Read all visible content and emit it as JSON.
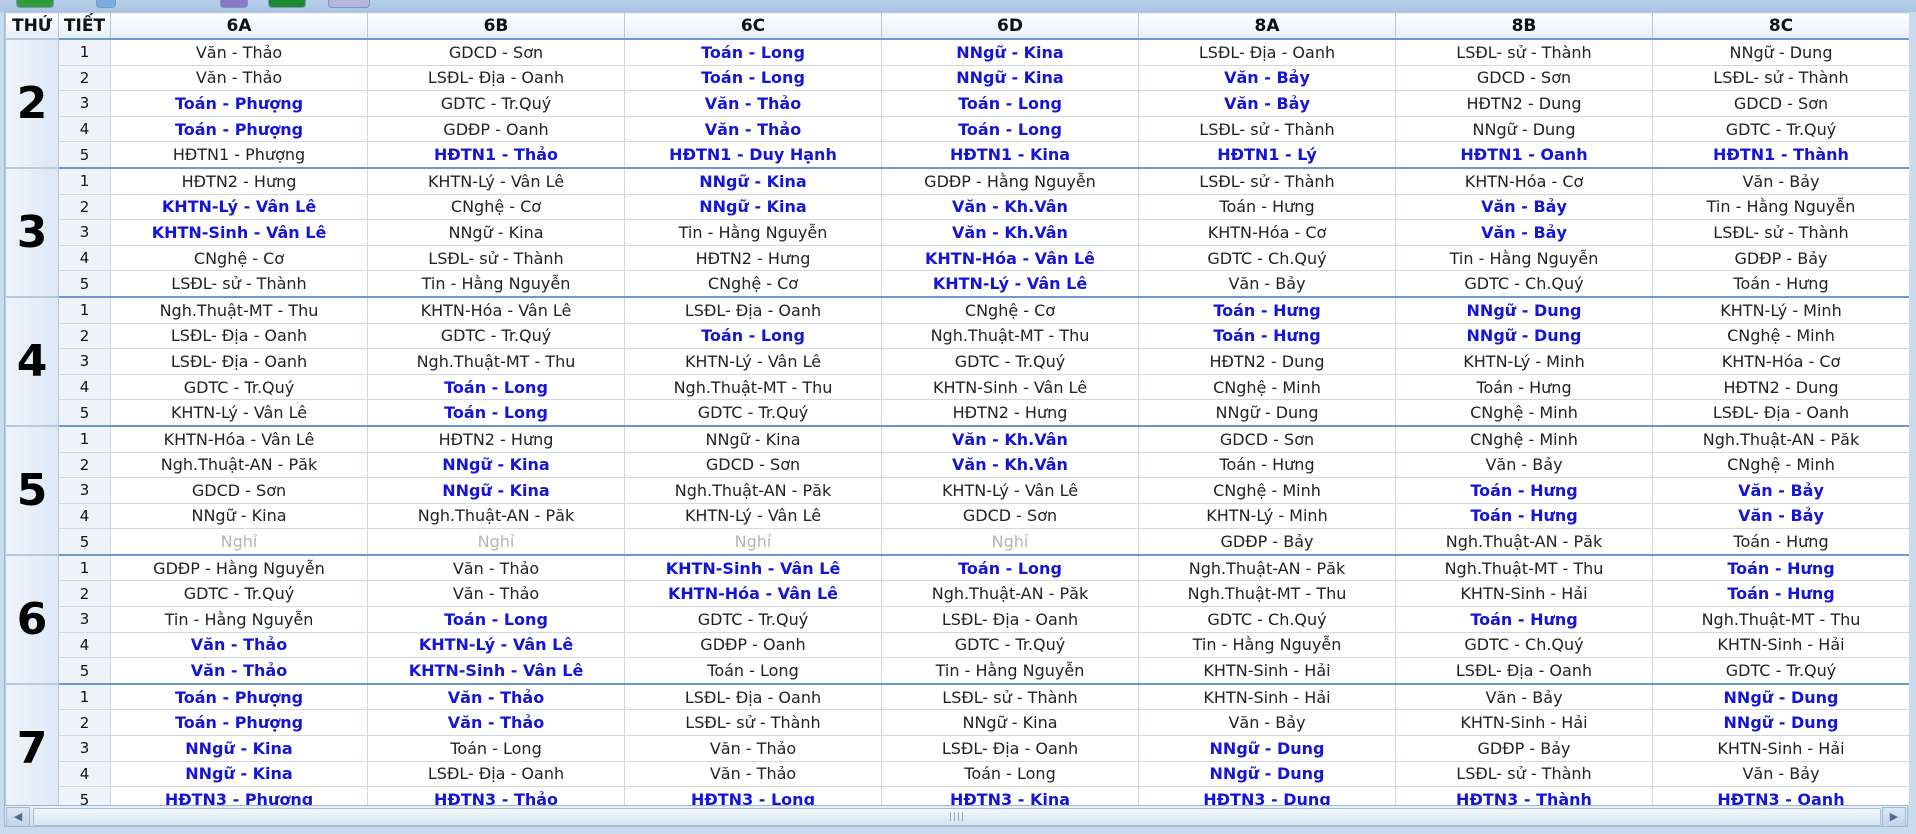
{
  "toolbar": {
    "button_colors": [
      "#2f9e3a",
      "#7aaee0",
      "#8a78c8",
      "#1e8a2e",
      "#b9b5dc"
    ]
  },
  "header": {
    "thu": "THỨ",
    "tiet": "TIẾT",
    "classes": [
      "6A",
      "6B",
      "6C",
      "6D",
      "8A",
      "8B",
      "8C"
    ]
  },
  "colors": {
    "highlight": "#1515d6",
    "normal": "#222222",
    "off": "#b5b5b5",
    "day_border": "#6d98cc"
  },
  "days": [
    {
      "day": "2",
      "rows": [
        [
          [
            "Văn - Thảo",
            0
          ],
          [
            "GDCD - Sơn",
            0
          ],
          [
            "Toán - Long",
            1
          ],
          [
            "NNgữ - Kina",
            1
          ],
          [
            "LSĐL- Địa - Oanh",
            0
          ],
          [
            "LSĐL- sử - Thành",
            0
          ],
          [
            "NNgữ - Dung",
            0
          ]
        ],
        [
          [
            "Văn - Thảo",
            0
          ],
          [
            "LSĐL- Địa - Oanh",
            0
          ],
          [
            "Toán - Long",
            1
          ],
          [
            "NNgữ - Kina",
            1
          ],
          [
            "Văn - Bảy",
            1
          ],
          [
            "GDCD - Sơn",
            0
          ],
          [
            "LSĐL- sử - Thành",
            0
          ]
        ],
        [
          [
            "Toán - Phượng",
            1
          ],
          [
            "GDTC - Tr.Quý",
            0
          ],
          [
            "Văn - Thảo",
            1
          ],
          [
            "Toán - Long",
            1
          ],
          [
            "Văn - Bảy",
            1
          ],
          [
            "HĐTN2 - Dung",
            0
          ],
          [
            "GDCD - Sơn",
            0
          ]
        ],
        [
          [
            "Toán - Phượng",
            1
          ],
          [
            "GDĐP - Oanh",
            0
          ],
          [
            "Văn - Thảo",
            1
          ],
          [
            "Toán - Long",
            1
          ],
          [
            "LSĐL- sử - Thành",
            0
          ],
          [
            "NNgữ - Dung",
            0
          ],
          [
            "GDTC - Tr.Quý",
            0
          ]
        ],
        [
          [
            "HĐTN1 - Phượng",
            0
          ],
          [
            "HĐTN1 - Thảo",
            1
          ],
          [
            "HĐTN1 - Duy Hạnh",
            1
          ],
          [
            "HĐTN1 - Kina",
            1
          ],
          [
            "HĐTN1 - Lý",
            1
          ],
          [
            "HĐTN1 - Oanh",
            1
          ],
          [
            "HĐTN1 - Thành",
            1
          ]
        ]
      ]
    },
    {
      "day": "3",
      "rows": [
        [
          [
            "HĐTN2 - Hưng",
            0
          ],
          [
            "KHTN-Lý - Vân Lê",
            0
          ],
          [
            "NNgữ - Kina",
            1
          ],
          [
            "GDĐP - Hằng Nguyễn",
            0
          ],
          [
            "LSĐL- sử - Thành",
            0
          ],
          [
            "KHTN-Hóa - Cơ",
            0
          ],
          [
            "Văn - Bảy",
            0
          ]
        ],
        [
          [
            "KHTN-Lý - Vân Lê",
            1
          ],
          [
            "CNghệ - Cơ",
            0
          ],
          [
            "NNgữ - Kina",
            1
          ],
          [
            "Văn - Kh.Vân",
            1
          ],
          [
            "Toán - Hưng",
            0
          ],
          [
            "Văn - Bảy",
            1
          ],
          [
            "Tin - Hằng Nguyễn",
            0
          ]
        ],
        [
          [
            "KHTN-Sinh - Vân Lê",
            1
          ],
          [
            "NNgữ - Kina",
            0
          ],
          [
            "Tin - Hằng Nguyễn",
            0
          ],
          [
            "Văn - Kh.Vân",
            1
          ],
          [
            "KHTN-Hóa - Cơ",
            0
          ],
          [
            "Văn - Bảy",
            1
          ],
          [
            "LSĐL- sử - Thành",
            0
          ]
        ],
        [
          [
            "CNghệ - Cơ",
            0
          ],
          [
            "LSĐL- sử - Thành",
            0
          ],
          [
            "HĐTN2 - Hưng",
            0
          ],
          [
            "KHTN-Hóa - Vân Lê",
            1
          ],
          [
            "GDTC - Ch.Quý",
            0
          ],
          [
            "Tin - Hằng Nguyễn",
            0
          ],
          [
            "GDĐP - Bảy",
            0
          ]
        ],
        [
          [
            "LSĐL- sử - Thành",
            0
          ],
          [
            "Tin - Hằng Nguyễn",
            0
          ],
          [
            "CNghệ - Cơ",
            0
          ],
          [
            "KHTN-Lý - Vân Lê",
            1
          ],
          [
            "Văn - Bảy",
            0
          ],
          [
            "GDTC - Ch.Quý",
            0
          ],
          [
            "Toán - Hưng",
            0
          ]
        ]
      ]
    },
    {
      "day": "4",
      "rows": [
        [
          [
            "Ngh.Thuật-MT - Thu",
            0
          ],
          [
            "KHTN-Hóa - Vân Lê",
            0
          ],
          [
            "LSĐL- Địa - Oanh",
            0
          ],
          [
            "CNghệ - Cơ",
            0
          ],
          [
            "Toán - Hưng",
            1
          ],
          [
            "NNgữ - Dung",
            1
          ],
          [
            "KHTN-Lý - Minh",
            0
          ]
        ],
        [
          [
            "LSĐL- Địa - Oanh",
            0
          ],
          [
            "GDTC - Tr.Quý",
            0
          ],
          [
            "Toán - Long",
            1
          ],
          [
            "Ngh.Thuật-MT - Thu",
            0
          ],
          [
            "Toán - Hưng",
            1
          ],
          [
            "NNgữ - Dung",
            1
          ],
          [
            "CNghệ - Minh",
            0
          ]
        ],
        [
          [
            "LSĐL- Địa - Oanh",
            0
          ],
          [
            "Ngh.Thuật-MT - Thu",
            0
          ],
          [
            "KHTN-Lý - Vân Lê",
            0
          ],
          [
            "GDTC - Tr.Quý",
            0
          ],
          [
            "HĐTN2 - Dung",
            0
          ],
          [
            "KHTN-Lý - Minh",
            0
          ],
          [
            "KHTN-Hóa - Cơ",
            0
          ]
        ],
        [
          [
            "GDTC - Tr.Quý",
            0
          ],
          [
            "Toán - Long",
            1
          ],
          [
            "Ngh.Thuật-MT - Thu",
            0
          ],
          [
            "KHTN-Sinh - Vân Lê",
            0
          ],
          [
            "CNghệ - Minh",
            0
          ],
          [
            "Toán - Hưng",
            0
          ],
          [
            "HĐTN2 - Dung",
            0
          ]
        ],
        [
          [
            "KHTN-Lý - Vân Lê",
            0
          ],
          [
            "Toán - Long",
            1
          ],
          [
            "GDTC - Tr.Quý",
            0
          ],
          [
            "HĐTN2 - Hưng",
            0
          ],
          [
            "NNgữ - Dung",
            0
          ],
          [
            "CNghệ - Minh",
            0
          ],
          [
            "LSĐL- Địa - Oanh",
            0
          ]
        ]
      ]
    },
    {
      "day": "5",
      "rows": [
        [
          [
            "KHTN-Hóa - Vân Lê",
            0
          ],
          [
            "HĐTN2 - Hưng",
            0
          ],
          [
            "NNgữ - Kina",
            0
          ],
          [
            "Văn - Kh.Vân",
            1
          ],
          [
            "GDCD - Sơn",
            0
          ],
          [
            "CNghệ - Minh",
            0
          ],
          [
            "Ngh.Thuật-AN - Păk",
            0
          ]
        ],
        [
          [
            "Ngh.Thuật-AN - Păk",
            0
          ],
          [
            "NNgữ - Kina",
            1
          ],
          [
            "GDCD - Sơn",
            0
          ],
          [
            "Văn - Kh.Vân",
            1
          ],
          [
            "Toán - Hưng",
            0
          ],
          [
            "Văn - Bảy",
            0
          ],
          [
            "CNghệ - Minh",
            0
          ]
        ],
        [
          [
            "GDCD - Sơn",
            0
          ],
          [
            "NNgữ - Kina",
            1
          ],
          [
            "Ngh.Thuật-AN - Păk",
            0
          ],
          [
            "KHTN-Lý - Vân Lê",
            0
          ],
          [
            "CNghệ - Minh",
            0
          ],
          [
            "Toán - Hưng",
            1
          ],
          [
            "Văn - Bảy",
            1
          ]
        ],
        [
          [
            "NNgữ - Kina",
            0
          ],
          [
            "Ngh.Thuật-AN - Păk",
            0
          ],
          [
            "KHTN-Lý - Vân Lê",
            0
          ],
          [
            "GDCD - Sơn",
            0
          ],
          [
            "KHTN-Lý - Minh",
            0
          ],
          [
            "Toán - Hưng",
            1
          ],
          [
            "Văn - Bảy",
            1
          ]
        ],
        [
          [
            "Nghỉ",
            2
          ],
          [
            "Nghỉ",
            2
          ],
          [
            "Nghỉ",
            2
          ],
          [
            "Nghỉ",
            2
          ],
          [
            "GDĐP - Bảy",
            0
          ],
          [
            "Ngh.Thuật-AN - Păk",
            0
          ],
          [
            "Toán - Hưng",
            0
          ]
        ]
      ]
    },
    {
      "day": "6",
      "rows": [
        [
          [
            "GDĐP - Hằng Nguyễn",
            0
          ],
          [
            "Văn - Thảo",
            0
          ],
          [
            "KHTN-Sinh - Vân Lê",
            1
          ],
          [
            "Toán - Long",
            1
          ],
          [
            "Ngh.Thuật-AN - Păk",
            0
          ],
          [
            "Ngh.Thuật-MT - Thu",
            0
          ],
          [
            "Toán - Hưng",
            1
          ]
        ],
        [
          [
            "GDTC - Tr.Quý",
            0
          ],
          [
            "Văn - Thảo",
            0
          ],
          [
            "KHTN-Hóa - Vân Lê",
            1
          ],
          [
            "Ngh.Thuật-AN - Păk",
            0
          ],
          [
            "Ngh.Thuật-MT - Thu",
            0
          ],
          [
            "KHTN-Sinh - Hải",
            0
          ],
          [
            "Toán - Hưng",
            1
          ]
        ],
        [
          [
            "Tin - Hằng Nguyễn",
            0
          ],
          [
            "Toán - Long",
            1
          ],
          [
            "GDTC - Tr.Quý",
            0
          ],
          [
            "LSĐL- Địa - Oanh",
            0
          ],
          [
            "GDTC - Ch.Quý",
            0
          ],
          [
            "Toán - Hưng",
            1
          ],
          [
            "Ngh.Thuật-MT - Thu",
            0
          ]
        ],
        [
          [
            "Văn - Thảo",
            1
          ],
          [
            "KHTN-Lý - Vân Lê",
            1
          ],
          [
            "GDĐP - Oanh",
            0
          ],
          [
            "GDTC - Tr.Quý",
            0
          ],
          [
            "Tin - Hằng Nguyễn",
            0
          ],
          [
            "GDTC - Ch.Quý",
            0
          ],
          [
            "KHTN-Sinh - Hải",
            0
          ]
        ],
        [
          [
            "Văn - Thảo",
            1
          ],
          [
            "KHTN-Sinh - Vân Lê",
            1
          ],
          [
            "Toán - Long",
            0
          ],
          [
            "Tin - Hằng Nguyễn",
            0
          ],
          [
            "KHTN-Sinh - Hải",
            0
          ],
          [
            "LSĐL- Địa - Oanh",
            0
          ],
          [
            "GDTC - Tr.Quý",
            0
          ]
        ]
      ]
    },
    {
      "day": "7",
      "rows": [
        [
          [
            "Toán - Phượng",
            1
          ],
          [
            "Văn - Thảo",
            1
          ],
          [
            "LSĐL- Địa - Oanh",
            0
          ],
          [
            "LSĐL- sử - Thành",
            0
          ],
          [
            "KHTN-Sinh - Hải",
            0
          ],
          [
            "Văn - Bảy",
            0
          ],
          [
            "NNgữ - Dung",
            1
          ]
        ],
        [
          [
            "Toán - Phượng",
            1
          ],
          [
            "Văn - Thảo",
            1
          ],
          [
            "LSĐL- sử - Thành",
            0
          ],
          [
            "NNgữ - Kina",
            0
          ],
          [
            "Văn - Bảy",
            0
          ],
          [
            "KHTN-Sinh - Hải",
            0
          ],
          [
            "NNgữ - Dung",
            1
          ]
        ],
        [
          [
            "NNgữ - Kina",
            1
          ],
          [
            "Toán - Long",
            0
          ],
          [
            "Văn - Thảo",
            0
          ],
          [
            "LSĐL- Địa - Oanh",
            0
          ],
          [
            "NNgữ - Dung",
            1
          ],
          [
            "GDĐP - Bảy",
            0
          ],
          [
            "KHTN-Sinh - Hải",
            0
          ]
        ],
        [
          [
            "NNgữ - Kina",
            1
          ],
          [
            "LSĐL- Địa - Oanh",
            0
          ],
          [
            "Văn - Thảo",
            0
          ],
          [
            "Toán - Long",
            0
          ],
          [
            "NNgữ - Dung",
            1
          ],
          [
            "LSĐL- sử - Thành",
            0
          ],
          [
            "Văn - Bảy",
            0
          ]
        ],
        [
          [
            "HĐTN3 - Phượng",
            1
          ],
          [
            "HĐTN3 - Thảo",
            1
          ],
          [
            "HĐTN3 - Long",
            1
          ],
          [
            "HĐTN3 - Kina",
            1
          ],
          [
            "HĐTN3 - Dung",
            1
          ],
          [
            "HĐTN3 - Thành",
            1
          ],
          [
            "HĐTN3 - Oanh",
            1
          ]
        ]
      ]
    }
  ],
  "scrollbar": {
    "left_arrow": "◀",
    "right_arrow": "▶",
    "grip": "||||"
  }
}
